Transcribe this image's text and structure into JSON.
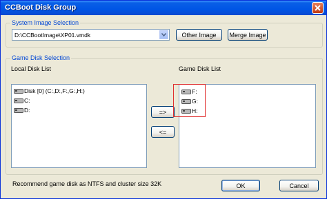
{
  "window": {
    "title": "CCBoot Disk Group"
  },
  "system_image": {
    "group_label": "System Image Selection",
    "selected_path": "D:\\CCBootImage\\XP01.vmdk",
    "other_image_label": "Other Image",
    "merge_image_label": "Merge Image"
  },
  "game_disk": {
    "group_label": "Game Disk Selection",
    "local_list_label": "Local Disk List",
    "game_list_label": "Game Disk List",
    "local_items": [
      "Disk [0] (C:,D:,F:,G:,H:)",
      "C:",
      "D:"
    ],
    "game_items": [
      "F:",
      "G:",
      "H:"
    ],
    "add_button_label": "=>",
    "remove_button_label": "<="
  },
  "footer": {
    "recommendation": "Recommend game disk as NTFS and cluster size 32K",
    "ok_label": "OK",
    "cancel_label": "Cancel"
  },
  "colors": {
    "titlebar": "#0055e5",
    "accent_text": "#0046d5",
    "highlight_box": "#e03030"
  }
}
